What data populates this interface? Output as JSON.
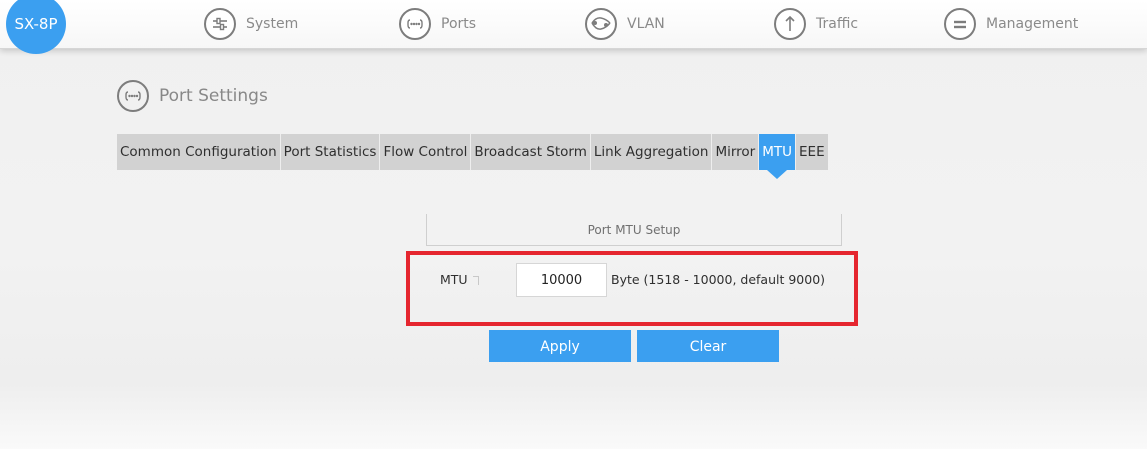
{
  "brand": {
    "label": "SX-8P"
  },
  "nav": [
    {
      "id": "system",
      "label": "System",
      "icon": "sliders-icon"
    },
    {
      "id": "ports",
      "label": "Ports",
      "icon": "ports-icon"
    },
    {
      "id": "vlan",
      "label": "VLAN",
      "icon": "vlan-icon"
    },
    {
      "id": "traffic",
      "label": "Traffic",
      "icon": "arrow-up-icon"
    },
    {
      "id": "management",
      "label": "Management",
      "icon": "equals-icon"
    }
  ],
  "section": {
    "title": "Port Settings",
    "icon": "ports-icon"
  },
  "tabs": [
    {
      "label": "Common Configuration",
      "active": false
    },
    {
      "label": "Port Statistics",
      "active": false
    },
    {
      "label": "Flow Control",
      "active": false
    },
    {
      "label": "Broadcast Storm",
      "active": false
    },
    {
      "label": "Link Aggregation",
      "active": false
    },
    {
      "label": "Mirror",
      "active": false
    },
    {
      "label": "MTU",
      "active": true
    },
    {
      "label": "EEE",
      "active": false
    }
  ],
  "panel": {
    "header": "Port MTU Setup",
    "mtu_label": "MTU",
    "mtu_value": "10000",
    "mtu_hint": "Byte (1518 - 10000, default 9000)",
    "apply_label": "Apply",
    "clear_label": "Clear"
  },
  "colors": {
    "accent": "#3b9ff0",
    "highlight": "#e5262f",
    "tab_bg": "#d2d2d2"
  }
}
